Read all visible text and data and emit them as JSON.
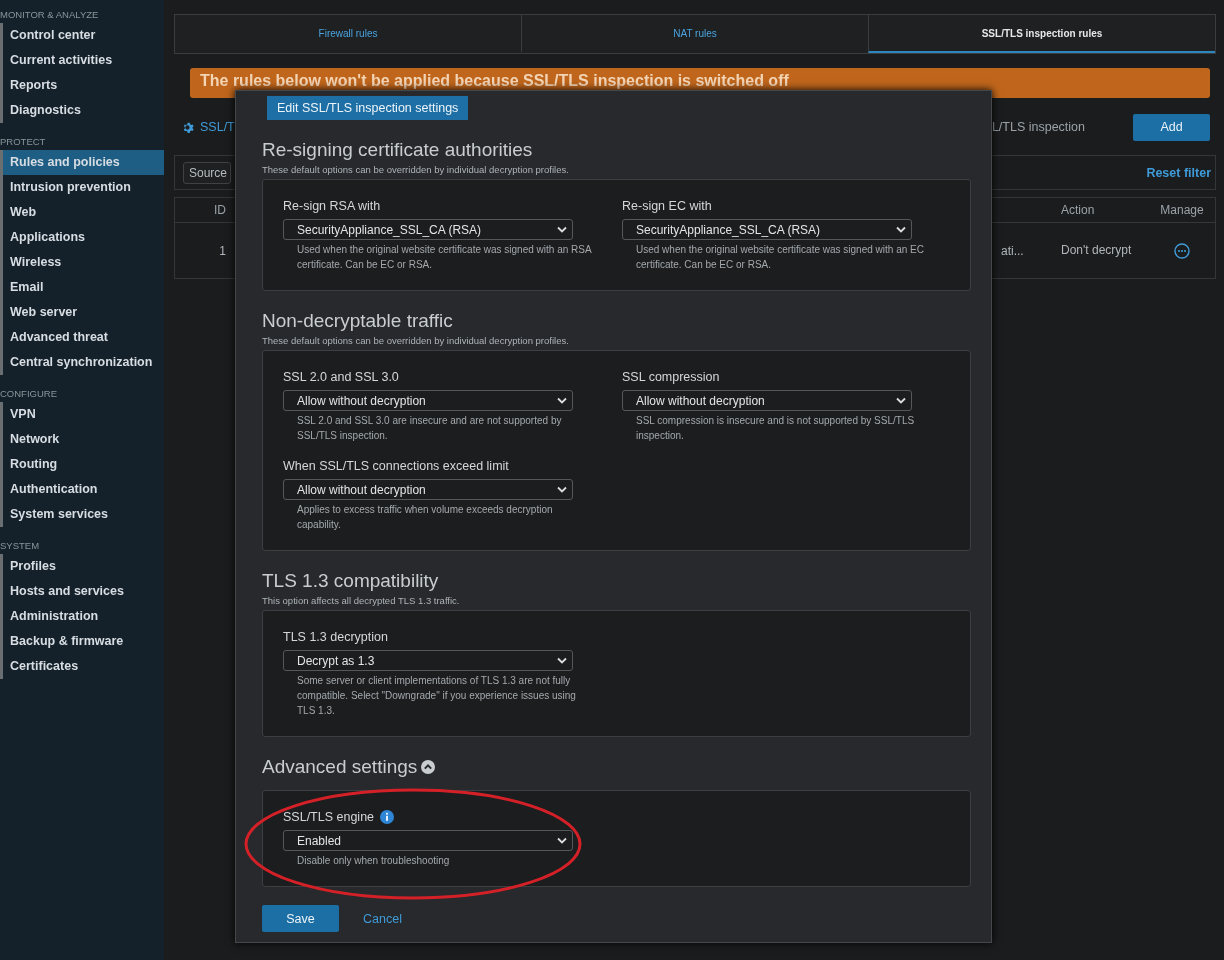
{
  "sidebar": {
    "groups": [
      {
        "heading": "MONITOR & ANALYZE",
        "items": [
          {
            "label": "Control center",
            "selected": false
          },
          {
            "label": "Current activities",
            "selected": false
          },
          {
            "label": "Reports",
            "selected": false
          },
          {
            "label": "Diagnostics",
            "selected": false
          }
        ]
      },
      {
        "heading": "PROTECT",
        "items": [
          {
            "label": "Rules and policies",
            "selected": true
          },
          {
            "label": "Intrusion prevention",
            "selected": false
          },
          {
            "label": "Web",
            "selected": false
          },
          {
            "label": "Applications",
            "selected": false
          },
          {
            "label": "Wireless",
            "selected": false
          },
          {
            "label": "Email",
            "selected": false
          },
          {
            "label": "Web server",
            "selected": false
          },
          {
            "label": "Advanced threat",
            "selected": false
          },
          {
            "label": "Central synchronization",
            "selected": false
          }
        ]
      },
      {
        "heading": "CONFIGURE",
        "items": [
          {
            "label": "VPN",
            "selected": false
          },
          {
            "label": "Network",
            "selected": false
          },
          {
            "label": "Routing",
            "selected": false
          },
          {
            "label": "Authentication",
            "selected": false
          },
          {
            "label": "System services",
            "selected": false
          }
        ]
      },
      {
        "heading": "SYSTEM",
        "items": [
          {
            "label": "Profiles",
            "selected": false
          },
          {
            "label": "Hosts and services",
            "selected": false
          },
          {
            "label": "Administration",
            "selected": false
          },
          {
            "label": "Backup & firmware",
            "selected": false
          },
          {
            "label": "Certificates",
            "selected": false
          }
        ]
      }
    ]
  },
  "tabs": [
    {
      "label": "Firewall rules",
      "selected": false
    },
    {
      "label": "NAT rules",
      "selected": false
    },
    {
      "label": "SSL/TLS inspection rules",
      "selected": true
    }
  ],
  "banner": {
    "text": "The rules below won't be applied because SSL/TLS inspection is switched off"
  },
  "toolbar": {
    "link": "SSL/T",
    "status": "L/TLS inspection",
    "add_button": "Add"
  },
  "filter": {
    "select": "Source",
    "reset": "Reset filter"
  },
  "table": {
    "columns": [
      "ID",
      "Action",
      "Manage"
    ],
    "rows": [
      {
        "id": "1",
        "column_3": "ati...",
        "action": "Don't decrypt"
      }
    ]
  },
  "modal": {
    "header": "Edit SSL/TLS inspection settings",
    "sections": [
      {
        "title": "Re-signing certificate authorities",
        "subtitle": "These default options can be overridden by individual decryption profiles.",
        "fields": [
          {
            "label": "Re-sign RSA with",
            "value": "SecurityAppliance_SSL_CA (RSA)",
            "help": "Used when the original website certificate was signed with an RSA certificate. Can be EC or RSA."
          },
          {
            "label": "Re-sign EC with",
            "value": "SecurityAppliance_SSL_CA (RSA)",
            "help": "Used when the original website certificate was signed with an EC certificate. Can be EC or RSA."
          }
        ]
      },
      {
        "title": "Non-decryptable traffic",
        "subtitle": "These default options can be overridden by individual decryption profiles.",
        "fields": [
          {
            "label": "SSL 2.0 and SSL 3.0",
            "value": "Allow without decryption",
            "help": "SSL 2.0 and SSL 3.0 are insecure and are not supported by SSL/TLS inspection."
          },
          {
            "label": "SSL compression",
            "value": "Allow without decryption",
            "help": "SSL compression is insecure and is not supported by SSL/TLS inspection."
          },
          {
            "label": "When SSL/TLS connections exceed limit",
            "value": "Allow without decryption",
            "help": "Applies to excess traffic when volume exceeds decryption capability."
          }
        ]
      },
      {
        "title": "TLS 1.3 compatibility",
        "subtitle": "This option affects all decrypted TLS 1.3 traffic.",
        "fields": [
          {
            "label": "TLS 1.3 decryption",
            "value": "Decrypt as 1.3",
            "help": "Some server or client implementations of TLS 1.3 are not fully compatible. Select \"Downgrade\" if you experience issues using TLS 1.3."
          }
        ]
      },
      {
        "title": "Advanced settings",
        "expanded": true,
        "fields": [
          {
            "label": "SSL/TLS engine",
            "info": true,
            "highlighted": true,
            "value": "Enabled",
            "help": "Disable only when troubleshooting"
          }
        ]
      }
    ],
    "buttons": {
      "save": "Save",
      "cancel": "Cancel"
    }
  }
}
